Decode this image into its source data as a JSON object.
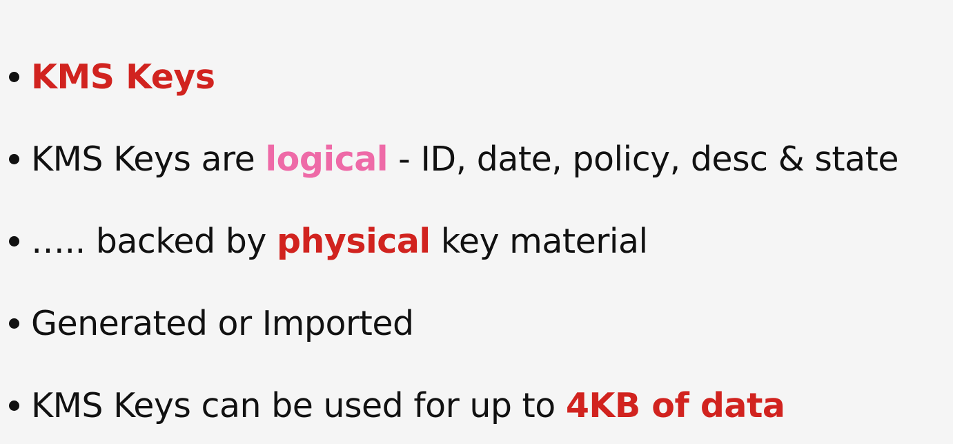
{
  "colors": {
    "background": "#f5f5f5",
    "text": "#111111",
    "accent_red": "#d1231f",
    "accent_pink": "#ee6aa7"
  },
  "bullets": [
    {
      "heading": "KMS Keys"
    },
    {
      "before": "KMS Keys are ",
      "highlight": "logical",
      "after": " - ID, date, policy, desc & state"
    },
    {
      "before": "….. backed by ",
      "highlight": "physical",
      "after": " key material"
    },
    {
      "text": "Generated or Imported"
    },
    {
      "before": "KMS Keys can be used for up to ",
      "highlight": "4KB of data"
    }
  ]
}
